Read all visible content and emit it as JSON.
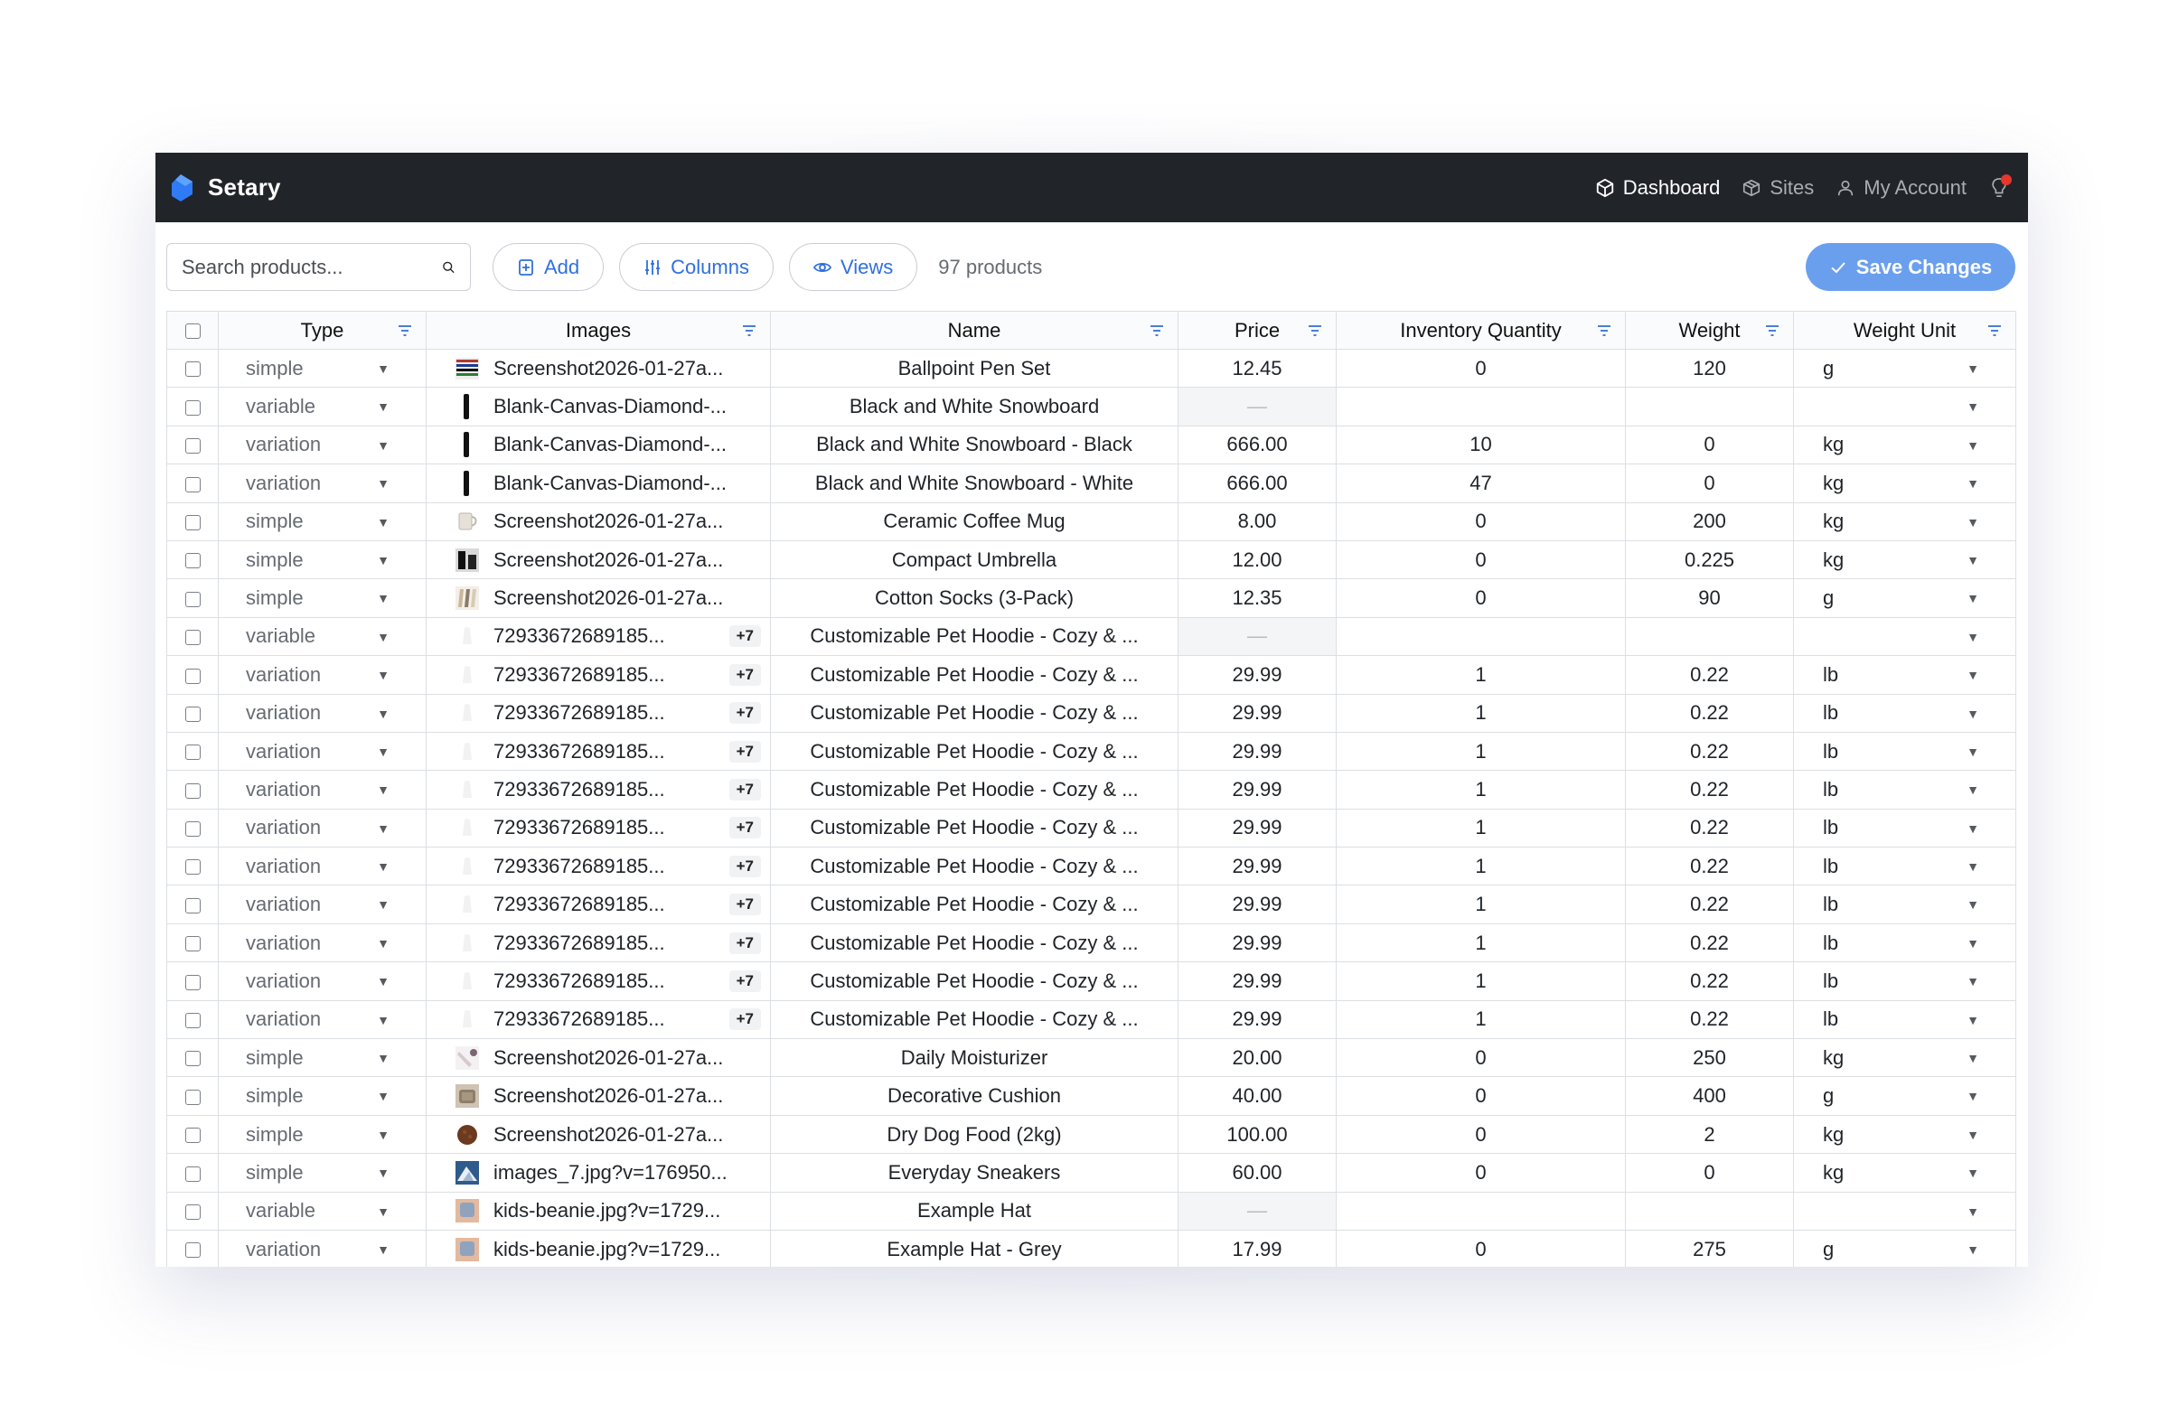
{
  "app": {
    "name": "Setary"
  },
  "nav": {
    "dashboard": "Dashboard",
    "sites": "Sites",
    "account": "My Account"
  },
  "toolbar": {
    "search_placeholder": "Search products...",
    "add_label": "Add",
    "columns_label": "Columns",
    "views_label": "Views",
    "product_count": "97 products",
    "save_label": "Save Changes"
  },
  "columns": [
    "Type",
    "Images",
    "Name",
    "Price",
    "Inventory Quantity",
    "Weight",
    "Weight Unit"
  ],
  "colors": {
    "accent": "#2f6fe0",
    "save": "#6a9fee",
    "navbar": "#212429",
    "fab": "#2a2adf",
    "badge": "#e5372c"
  },
  "rows": [
    {
      "type": "simple",
      "thumb": "pens",
      "image": "Screenshot2026-01-27a...",
      "plus": "",
      "name": "Ballpoint Pen Set",
      "price": "12.45",
      "inventory": "0",
      "weight": "120",
      "unit": "g"
    },
    {
      "type": "variable",
      "thumb": "board",
      "image": "Blank-Canvas-Diamond-...",
      "plus": "",
      "name": "Black and White Snowboard",
      "price": "—",
      "inventory": "",
      "weight": "",
      "unit": ""
    },
    {
      "type": "variation",
      "thumb": "board",
      "image": "Blank-Canvas-Diamond-...",
      "plus": "",
      "name": "Black and White Snowboard - Black",
      "price": "666.00",
      "inventory": "10",
      "weight": "0",
      "unit": "kg"
    },
    {
      "type": "variation",
      "thumb": "board",
      "image": "Blank-Canvas-Diamond-...",
      "plus": "",
      "name": "Black and White Snowboard - White",
      "price": "666.00",
      "inventory": "47",
      "weight": "0",
      "unit": "kg"
    },
    {
      "type": "simple",
      "thumb": "mug",
      "image": "Screenshot2026-01-27a...",
      "plus": "",
      "name": "Ceramic Coffee Mug",
      "price": "8.00",
      "inventory": "0",
      "weight": "200",
      "unit": "kg"
    },
    {
      "type": "simple",
      "thumb": "umbrella",
      "image": "Screenshot2026-01-27a...",
      "plus": "",
      "name": "Compact Umbrella",
      "price": "12.00",
      "inventory": "0",
      "weight": "0.225",
      "unit": "kg"
    },
    {
      "type": "simple",
      "thumb": "socks",
      "image": "Screenshot2026-01-27a...",
      "plus": "",
      "name": "Cotton Socks (3-Pack)",
      "price": "12.35",
      "inventory": "0",
      "weight": "90",
      "unit": "g"
    },
    {
      "type": "variable",
      "thumb": "hoodie",
      "image": "72933672689185...",
      "plus": "+7",
      "name": "Customizable Pet Hoodie - Cozy & ...",
      "price": "—",
      "inventory": "",
      "weight": "",
      "unit": ""
    },
    {
      "type": "variation",
      "thumb": "hoodie",
      "image": "72933672689185...",
      "plus": "+7",
      "name": "Customizable Pet Hoodie - Cozy & ...",
      "price": "29.99",
      "inventory": "1",
      "weight": "0.22",
      "unit": "lb"
    },
    {
      "type": "variation",
      "thumb": "hoodie",
      "image": "72933672689185...",
      "plus": "+7",
      "name": "Customizable Pet Hoodie - Cozy & ...",
      "price": "29.99",
      "inventory": "1",
      "weight": "0.22",
      "unit": "lb"
    },
    {
      "type": "variation",
      "thumb": "hoodie",
      "image": "72933672689185...",
      "plus": "+7",
      "name": "Customizable Pet Hoodie - Cozy & ...",
      "price": "29.99",
      "inventory": "1",
      "weight": "0.22",
      "unit": "lb"
    },
    {
      "type": "variation",
      "thumb": "hoodie",
      "image": "72933672689185...",
      "plus": "+7",
      "name": "Customizable Pet Hoodie - Cozy & ...",
      "price": "29.99",
      "inventory": "1",
      "weight": "0.22",
      "unit": "lb"
    },
    {
      "type": "variation",
      "thumb": "hoodie",
      "image": "72933672689185...",
      "plus": "+7",
      "name": "Customizable Pet Hoodie - Cozy & ...",
      "price": "29.99",
      "inventory": "1",
      "weight": "0.22",
      "unit": "lb"
    },
    {
      "type": "variation",
      "thumb": "hoodie",
      "image": "72933672689185...",
      "plus": "+7",
      "name": "Customizable Pet Hoodie - Cozy & ...",
      "price": "29.99",
      "inventory": "1",
      "weight": "0.22",
      "unit": "lb"
    },
    {
      "type": "variation",
      "thumb": "hoodie",
      "image": "72933672689185...",
      "plus": "+7",
      "name": "Customizable Pet Hoodie - Cozy & ...",
      "price": "29.99",
      "inventory": "1",
      "weight": "0.22",
      "unit": "lb"
    },
    {
      "type": "variation",
      "thumb": "hoodie",
      "image": "72933672689185...",
      "plus": "+7",
      "name": "Customizable Pet Hoodie - Cozy & ...",
      "price": "29.99",
      "inventory": "1",
      "weight": "0.22",
      "unit": "lb"
    },
    {
      "type": "variation",
      "thumb": "hoodie",
      "image": "72933672689185...",
      "plus": "+7",
      "name": "Customizable Pet Hoodie - Cozy & ...",
      "price": "29.99",
      "inventory": "1",
      "weight": "0.22",
      "unit": "lb"
    },
    {
      "type": "variation",
      "thumb": "hoodie",
      "image": "72933672689185...",
      "plus": "+7",
      "name": "Customizable Pet Hoodie - Cozy & ...",
      "price": "29.99",
      "inventory": "1",
      "weight": "0.22",
      "unit": "lb"
    },
    {
      "type": "simple",
      "thumb": "moisturizer",
      "image": "Screenshot2026-01-27a...",
      "plus": "",
      "name": "Daily Moisturizer",
      "price": "20.00",
      "inventory": "0",
      "weight": "250",
      "unit": "kg"
    },
    {
      "type": "simple",
      "thumb": "cushion",
      "image": "Screenshot2026-01-27a...",
      "plus": "",
      "name": "Decorative Cushion",
      "price": "40.00",
      "inventory": "0",
      "weight": "400",
      "unit": "g"
    },
    {
      "type": "simple",
      "thumb": "dogfood",
      "image": "Screenshot2026-01-27a...",
      "plus": "",
      "name": "Dry Dog Food (2kg)",
      "price": "100.00",
      "inventory": "0",
      "weight": "2",
      "unit": "kg"
    },
    {
      "type": "simple",
      "thumb": "sneakers",
      "image": "images_7.jpg?v=176950...",
      "plus": "",
      "name": "Everyday Sneakers",
      "price": "60.00",
      "inventory": "0",
      "weight": "0",
      "unit": "kg"
    },
    {
      "type": "variable",
      "thumb": "hat",
      "image": "kids-beanie.jpg?v=1729...",
      "plus": "",
      "name": "Example Hat",
      "price": "—",
      "inventory": "",
      "weight": "",
      "unit": ""
    },
    {
      "type": "variation",
      "thumb": "hat",
      "image": "kids-beanie.jpg?v=1729...",
      "plus": "",
      "name": "Example Hat - Grey",
      "price": "17.99",
      "inventory": "0",
      "weight": "275",
      "unit": "g"
    }
  ]
}
